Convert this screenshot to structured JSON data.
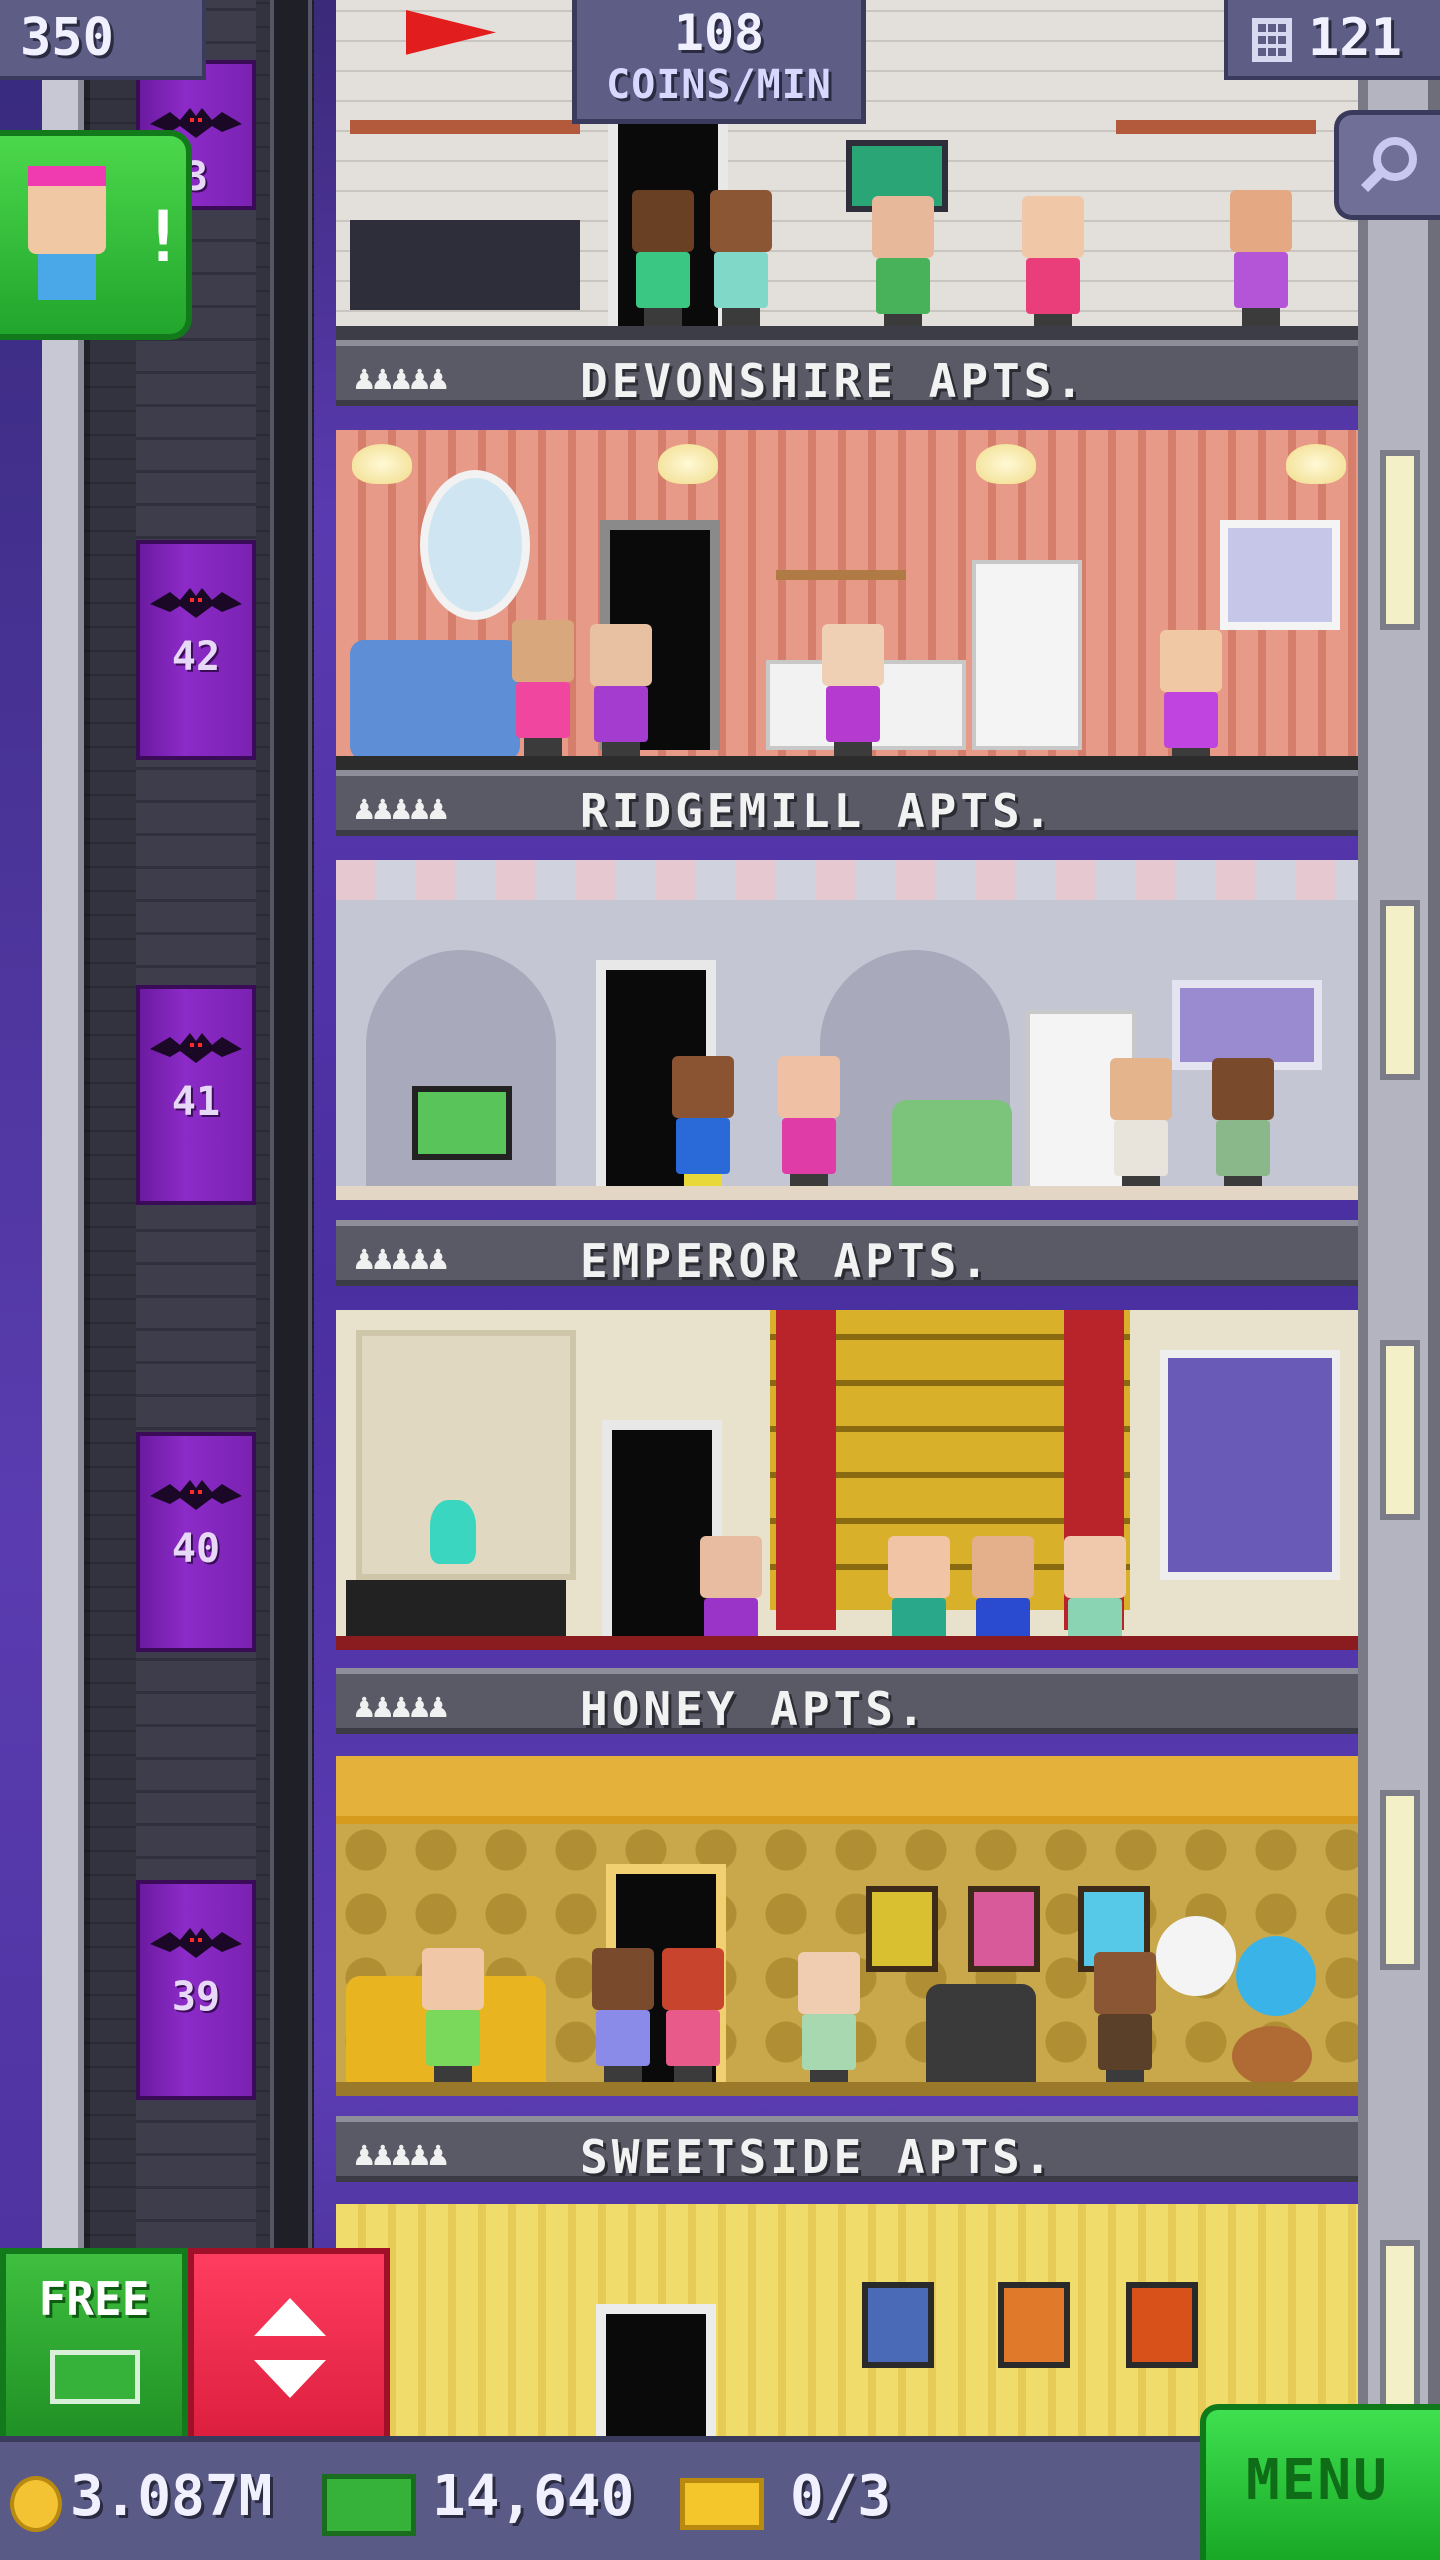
{
  "hud": {
    "population": "350",
    "coins_per_min_value": "108",
    "coins_per_min_label": "COINS/MIN",
    "floor_count": "121"
  },
  "elevator_shaft": {
    "floor_numbers": [
      "3",
      "42",
      "41",
      "40",
      "39"
    ]
  },
  "floors": [
    {
      "name": "DEVONSHIRE APTS.",
      "people_icons": "♟♟♟♟♟",
      "theme": "dorm"
    },
    {
      "name": "RIDGEMILL APTS.",
      "people_icons": "♟♟♟♟♟",
      "theme": "peach-striped"
    },
    {
      "name": "EMPEROR APTS.",
      "people_icons": "♟♟♟♟♟",
      "theme": "grey-arches"
    },
    {
      "name": "HONEY APTS.",
      "people_icons": "♟♟♟♟♟",
      "theme": "theater-cream"
    },
    {
      "name": "SWEETSIDE APTS.",
      "people_icons": "♟♟♟♟♟",
      "theme": "honeycomb"
    },
    {
      "name": "",
      "people_icons": "",
      "theme": "yellow-gallery"
    }
  ],
  "bottom": {
    "free_label": "FREE",
    "coins": "3.087M",
    "bux": "14,640",
    "vip": "0/3",
    "menu_label": "MENU"
  },
  "colors": {
    "hud_bg": "#5d5d86",
    "accent_green": "#22a52c",
    "accent_red": "#dc1e3e",
    "elevator_purple": "#8c2bc8"
  },
  "icons": {
    "population": "person-icon",
    "floors": "building-icon",
    "search": "magnifier-icon",
    "coin": "coin-icon",
    "bux": "tower-bux-icon",
    "vip": "golden-ticket-icon"
  }
}
